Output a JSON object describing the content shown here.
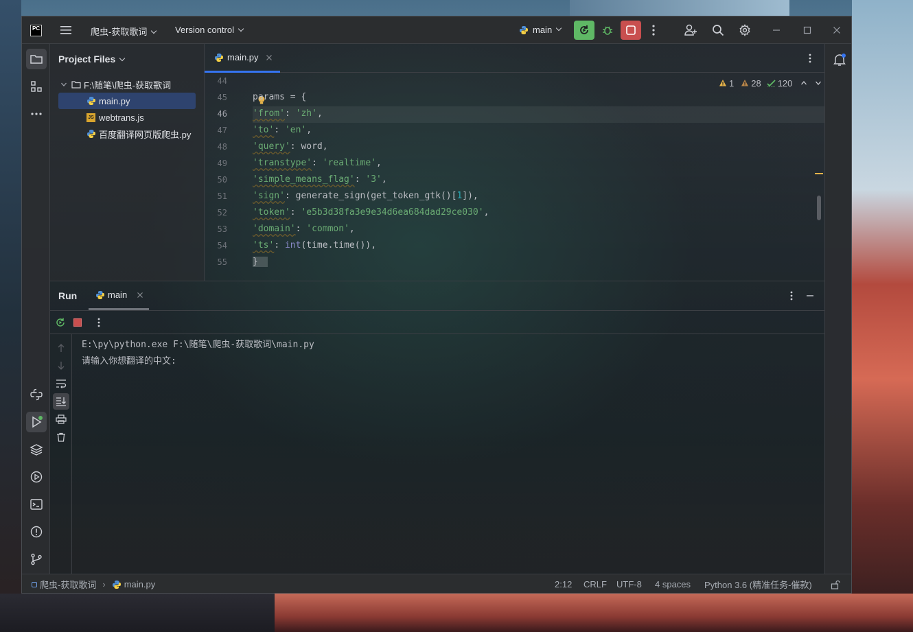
{
  "window": {
    "logo": "PC",
    "project_name": "爬虫-获取歌词",
    "vcs_label": "Version control",
    "run_config": "main"
  },
  "colors": {
    "accent": "#3574f0",
    "run_green": "#5fb865",
    "stop_red": "#c94f4f",
    "string": "#6aab73",
    "number": "#2aacb8"
  },
  "project_panel": {
    "title": "Project Files",
    "root": "F:\\随笔\\爬虫-获取歌词",
    "files": [
      {
        "name": "main.py",
        "icon": "python-file-icon",
        "selected": true
      },
      {
        "name": "webtrans.js",
        "icon": "js-file-icon",
        "selected": false
      },
      {
        "name": "百度翻译网页版爬虫.py",
        "icon": "python-file-icon",
        "selected": false
      }
    ]
  },
  "editor": {
    "tab": "main.py",
    "inspections": {
      "warnings": "1",
      "weak_warnings": "28",
      "typos": "120"
    },
    "line_numbers": [
      "44",
      "45",
      "46",
      "47",
      "48",
      "49",
      "50",
      "51",
      "52",
      "53",
      "54",
      "55"
    ],
    "current_line": "46",
    "code": {
      "l45": "params = {",
      "l46_key": "'from'",
      "l46_val": "'zh'",
      "l47_key": "'to'",
      "l47_val": "'en'",
      "l48_key": "'query'",
      "l48_val": "word",
      "l49_key": "'transtype'",
      "l49_val": "'realtime'",
      "l50_key": "'simple_means_flag'",
      "l50_val": "'3'",
      "l51_key": "'sign'",
      "l51_pre": "generate_sign(get_token_gtk()[",
      "l51_num": "1",
      "l51_post": "]),",
      "l52_key": "'token'",
      "l52_val": "'e5b3d38fa3e9e34d6ea684dad29ce030'",
      "l53_key": "'domain'",
      "l53_val": "'common'",
      "l54_key": "'ts'",
      "l54_fn": "int",
      "l54_rest": "(time.time()),",
      "l55": "}"
    }
  },
  "run": {
    "title": "Run",
    "tab": "main",
    "console": [
      "E:\\py\\python.exe F:\\随笔\\爬虫-获取歌词\\main.py",
      "请输入你想翻译的中文:"
    ]
  },
  "statusbar": {
    "project": "爬虫-获取歌词",
    "file": "main.py",
    "position": "2:12",
    "line_sep": "CRLF",
    "encoding": "UTF-8",
    "indent": "4 spaces",
    "interpreter": "Python 3.6 (精准任务-催款)"
  }
}
